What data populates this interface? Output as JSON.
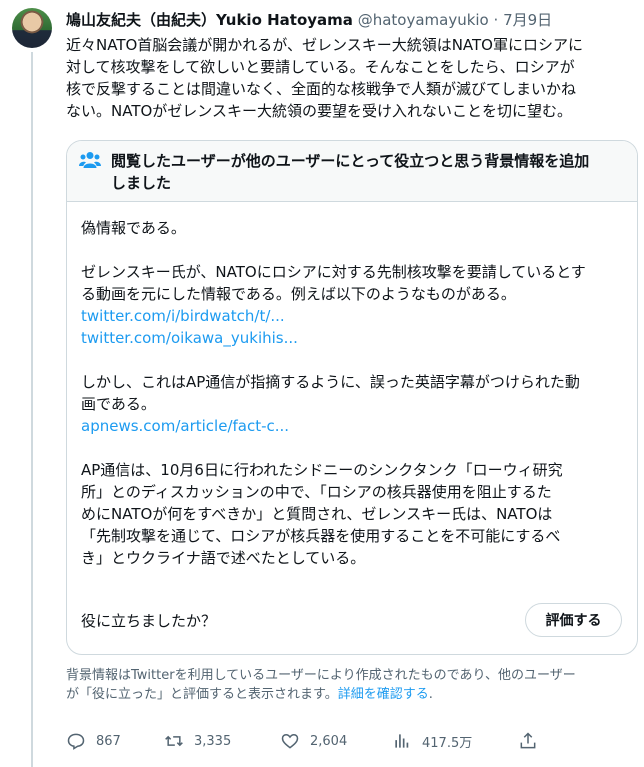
{
  "tweet": {
    "name": "鳩山友紀夫（由紀夫）Yukio Hatoyama",
    "handle": "@hatoyamayukio",
    "separator": "·",
    "date": "7月9日",
    "text": "近々NATO首脳会議が開かれるが、ゼレンスキー大統領はNATO軍にロシアに\n対して核攻撃をして欲しいと要請している。そんなことをしたら、ロシアが\n核で反撃することは間違いなく、全面的な核戦争で人類が滅びてしまいかね\nない。NATOがゼレンスキー大統領の要望を受け入れないことを切に望む。"
  },
  "note": {
    "title": "閲覧したユーザーが他のユーザーにとって役立つと思う背景情報を追加\nしました",
    "para1": "偽情報である。",
    "para2": "ゼレンスキー氏が、NATOにロシアに対する先制核攻撃を要請しているとす\nる動画を元にした情報である。例えば以下のようなものがある。",
    "link1": "twitter.com/i/birdwatch/t/...",
    "link2": "twitter.com/oikawa_yukihis...",
    "para3": "しかし、これはAP通信が指摘するように、誤った英語字幕がつけられた動\n画である。",
    "link3": "apnews.com/article/fact-c...",
    "para4": "AP通信は、10月6日に行われたシドニーのシンクタンク「ローウィ研究\n所」とのディスカッションの中で、「ロシアの核兵器使用を阻止するた\nめにNATOが何をすべきか」と質問され、ゼレンスキー氏は、NATOは\n「先制攻撃を通じて、ロシアが核兵器を使用することを不可能にするべ\nき」とウクライナ語で述べたとしている。",
    "question": "役に立ちましたか？",
    "rate_button": "評価する"
  },
  "disclaimer": {
    "text": "背景情報はTwitterを利用しているユーザーにより作成されたものであり、他のユーザー\nが「役に立った」と評価すると表示されます。",
    "link": "詳細を確認する"
  },
  "actions": {
    "reply_count": "867",
    "retweet_count": "3,335",
    "like_count": "2,604",
    "views_count": "417.5万",
    "icons": [
      "reply-icon",
      "retweet-icon",
      "like-icon",
      "views-icon",
      "share-icon"
    ]
  },
  "colors": {
    "link": "#1d9bf0",
    "muted": "#536471",
    "text": "#0f1419",
    "border": "#cfd9de"
  }
}
